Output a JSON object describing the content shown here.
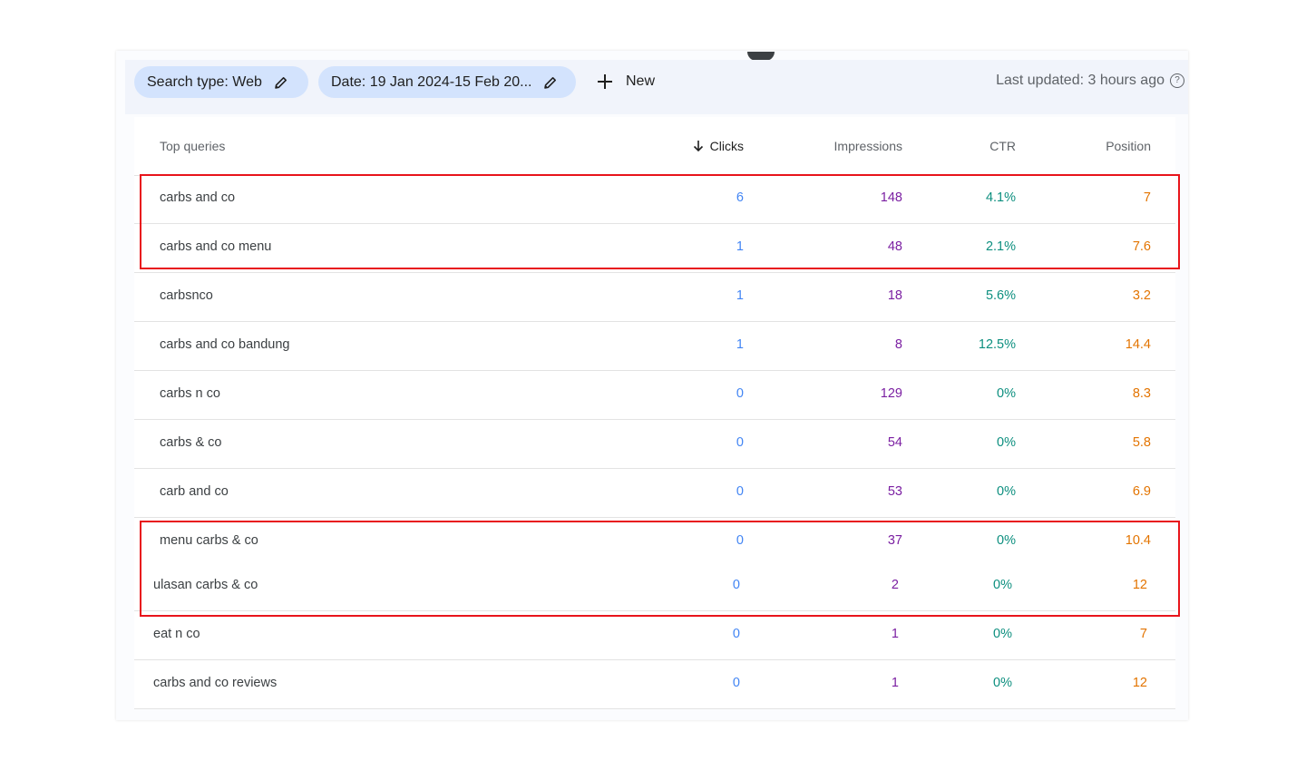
{
  "filters": {
    "search_type": "Search type: Web",
    "date": "Date: 19 Jan 2024-15 Feb 20...",
    "new_label": "New",
    "last_updated": "Last updated: 3 hours ago",
    "help_glyph": "?"
  },
  "table": {
    "headers": {
      "query": "Top queries",
      "clicks": "Clicks",
      "impressions": "Impressions",
      "ctr": "CTR",
      "position": "Position"
    },
    "sort": {
      "column": "clicks",
      "direction": "descending"
    },
    "rows": [
      {
        "query": "carbs and co",
        "clicks": "6",
        "impressions": "148",
        "ctr": "4.1%",
        "position": "7"
      },
      {
        "query": "carbs and co menu",
        "clicks": "1",
        "impressions": "48",
        "ctr": "2.1%",
        "position": "7.6"
      },
      {
        "query": "carbsnco",
        "clicks": "1",
        "impressions": "18",
        "ctr": "5.6%",
        "position": "3.2"
      },
      {
        "query": "carbs and co bandung",
        "clicks": "1",
        "impressions": "8",
        "ctr": "12.5%",
        "position": "14.4"
      },
      {
        "query": "carbs n co",
        "clicks": "0",
        "impressions": "129",
        "ctr": "0%",
        "position": "8.3"
      },
      {
        "query": "carbs & co",
        "clicks": "0",
        "impressions": "54",
        "ctr": "0%",
        "position": "5.8"
      },
      {
        "query": "carb and co",
        "clicks": "0",
        "impressions": "53",
        "ctr": "0%",
        "position": "6.9"
      },
      {
        "query": "menu carbs & co",
        "clicks": "0",
        "impressions": "37",
        "ctr": "0%",
        "position": "10.4"
      },
      {
        "query": "ulasan carbs & co",
        "clicks": "0",
        "impressions": "2",
        "ctr": "0%",
        "position": "12"
      },
      {
        "query": "eat n co",
        "clicks": "0",
        "impressions": "1",
        "ctr": "0%",
        "position": "7"
      },
      {
        "query": "carbs and co reviews",
        "clicks": "0",
        "impressions": "1",
        "ctr": "0%",
        "position": "12"
      }
    ]
  },
  "colors": {
    "clicks": "#4285f4",
    "impressions": "#7b1fa2",
    "ctr": "#0d8f7f",
    "position": "#e37400",
    "highlight_box": "#e8141b",
    "chip": "#d3e3fd"
  },
  "icons": [
    "pencil-icon",
    "plus-icon",
    "help-icon",
    "arrow-down-icon"
  ]
}
